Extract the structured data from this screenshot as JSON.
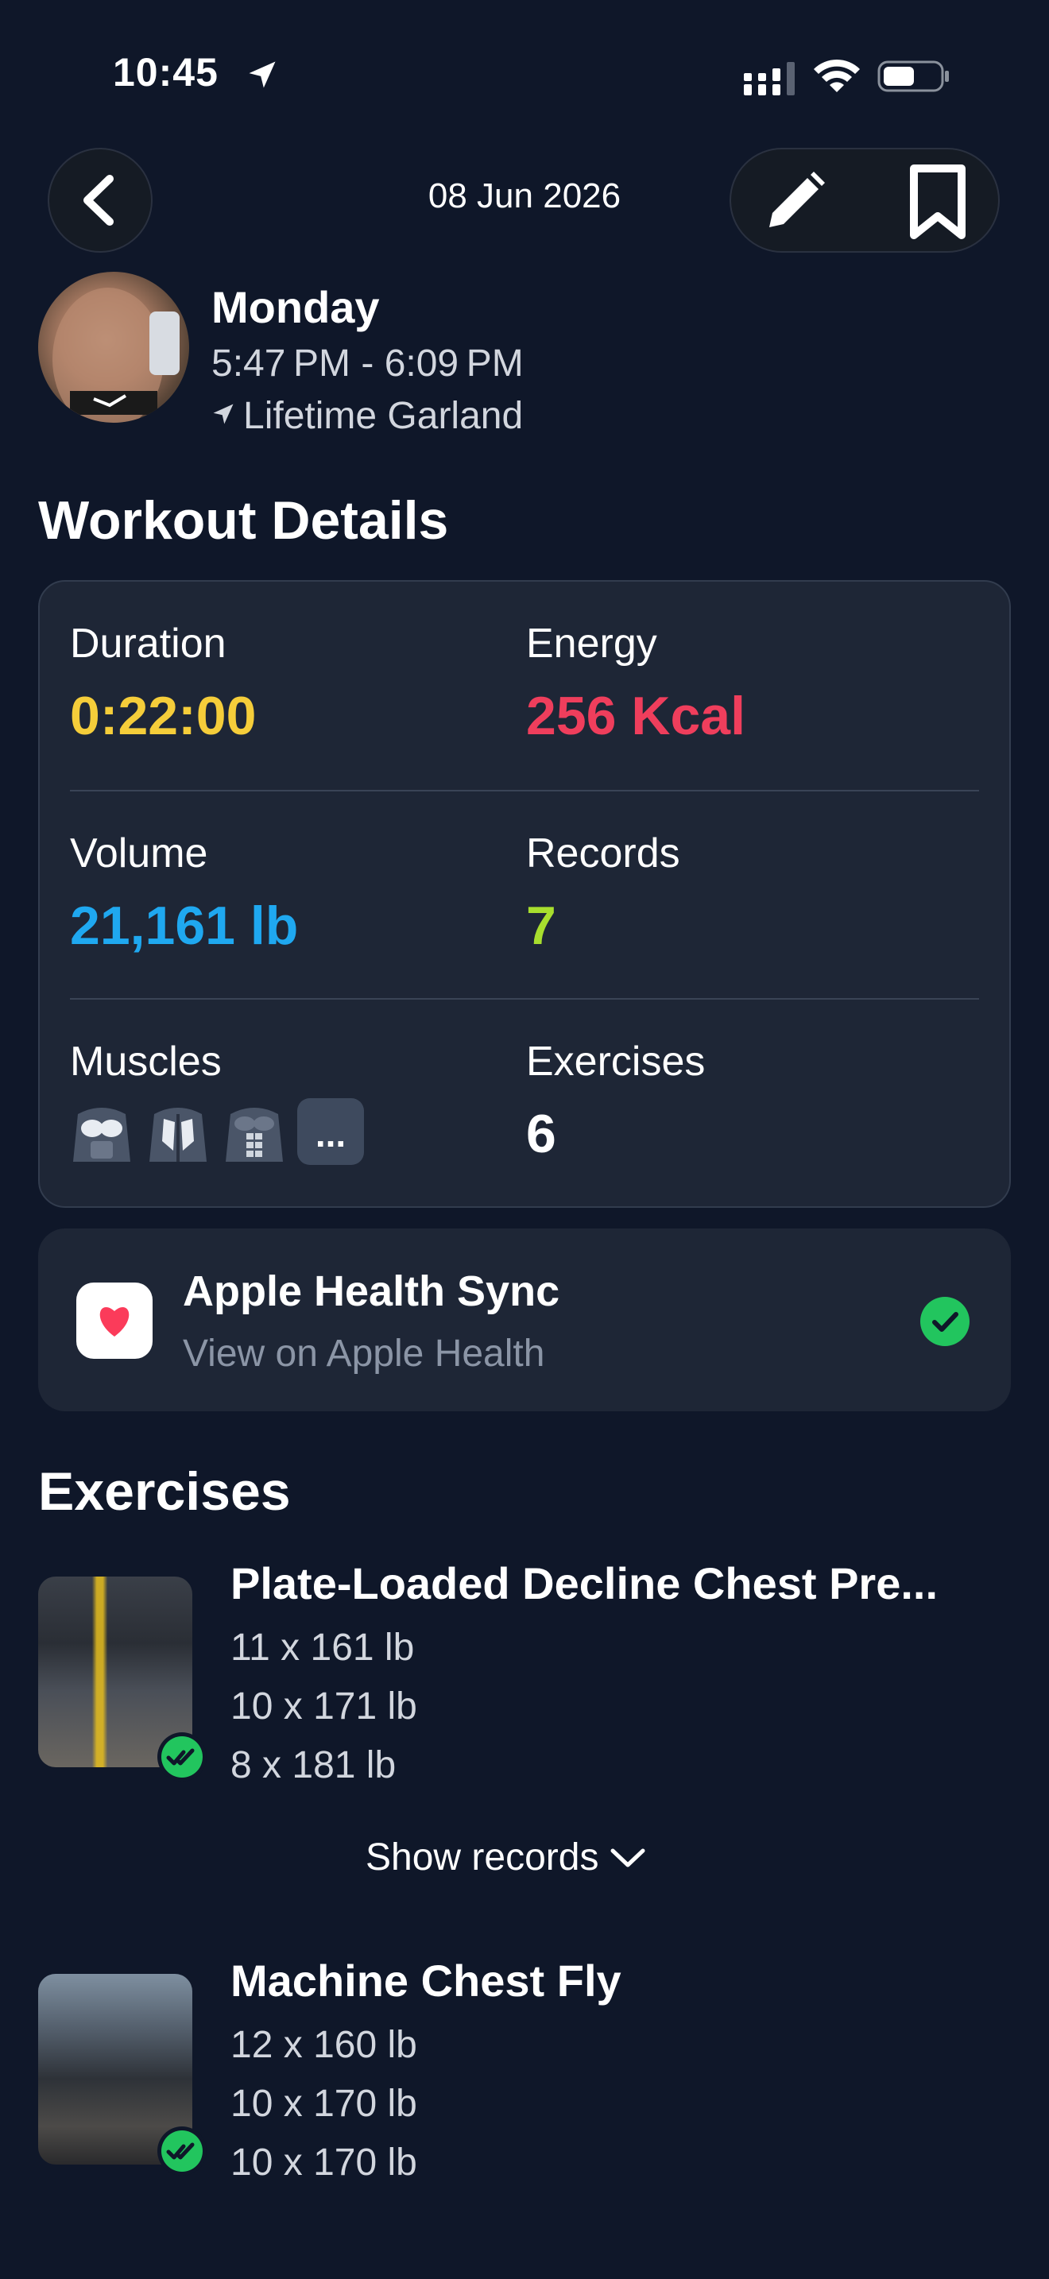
{
  "status_bar": {
    "time": "10:45"
  },
  "header": {
    "date": "08 Jun 2026"
  },
  "profile": {
    "day": "Monday",
    "time_range": "5:47 PM - 6:09 PM",
    "location": "Lifetime Garland"
  },
  "workout_details": {
    "title": "Workout Details",
    "duration": {
      "label": "Duration",
      "value": "0:22:00",
      "color": "#f5cd3a"
    },
    "energy": {
      "label": "Energy",
      "value": "256 Kcal",
      "color": "#ef3e5c"
    },
    "volume": {
      "label": "Volume",
      "value": "21,161 lb",
      "color": "#1fa8f0"
    },
    "records": {
      "label": "Records",
      "value": "7",
      "color": "#a8de2e"
    },
    "muscles": {
      "label": "Muscles",
      "icons": [
        "chest-muscle-icon",
        "back-muscle-icon",
        "abs-muscle-icon"
      ],
      "more": "..."
    },
    "exercises": {
      "label": "Exercises",
      "value": "6"
    }
  },
  "health": {
    "title": "Apple Health Sync",
    "subtitle": "View on Apple Health",
    "check_color": "#22c55e"
  },
  "exercises_section": {
    "title": "Exercises",
    "items": [
      {
        "name": "Plate-Loaded Decline Chest Pre...",
        "sets": [
          "11 x 161 lb",
          "10 x 171 lb",
          "8 x 181 lb"
        ]
      },
      {
        "name": "Machine Chest Fly",
        "sets": [
          "12 x 160 lb",
          "10 x 170 lb",
          "10 x 170 lb"
        ]
      }
    ],
    "show_records": "Show records"
  }
}
